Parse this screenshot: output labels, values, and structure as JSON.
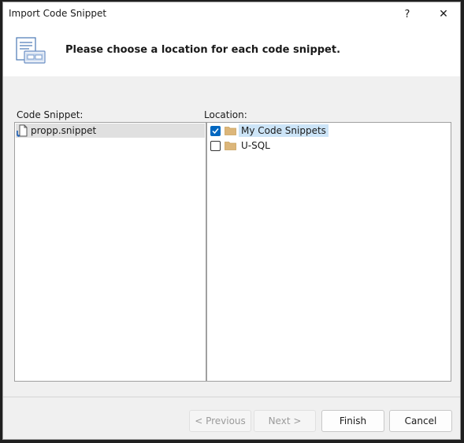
{
  "window": {
    "title": "Import Code Snippet",
    "help_glyph": "?",
    "close_glyph": "✕"
  },
  "header": {
    "icon": "code-snippet-import-icon",
    "instruction": "Please choose a location for each code snippet."
  },
  "snippet_panel": {
    "label": "Code Snippet:",
    "items": [
      {
        "name": "propp.snippet",
        "icon": "snippet-file-icon",
        "selected": true
      }
    ]
  },
  "location_panel": {
    "label": "Location:",
    "items": [
      {
        "name": "My Code Snippets",
        "checked": true,
        "icon": "folder-icon",
        "selected": true
      },
      {
        "name": "U-SQL",
        "checked": false,
        "icon": "folder-icon",
        "selected": false
      }
    ]
  },
  "buttons": {
    "previous": "< Previous",
    "next": "Next >",
    "finish": "Finish",
    "cancel": "Cancel"
  },
  "colors": {
    "accent": "#0067c0",
    "selection": "#cce4f7",
    "folder": "#dcb67a"
  }
}
